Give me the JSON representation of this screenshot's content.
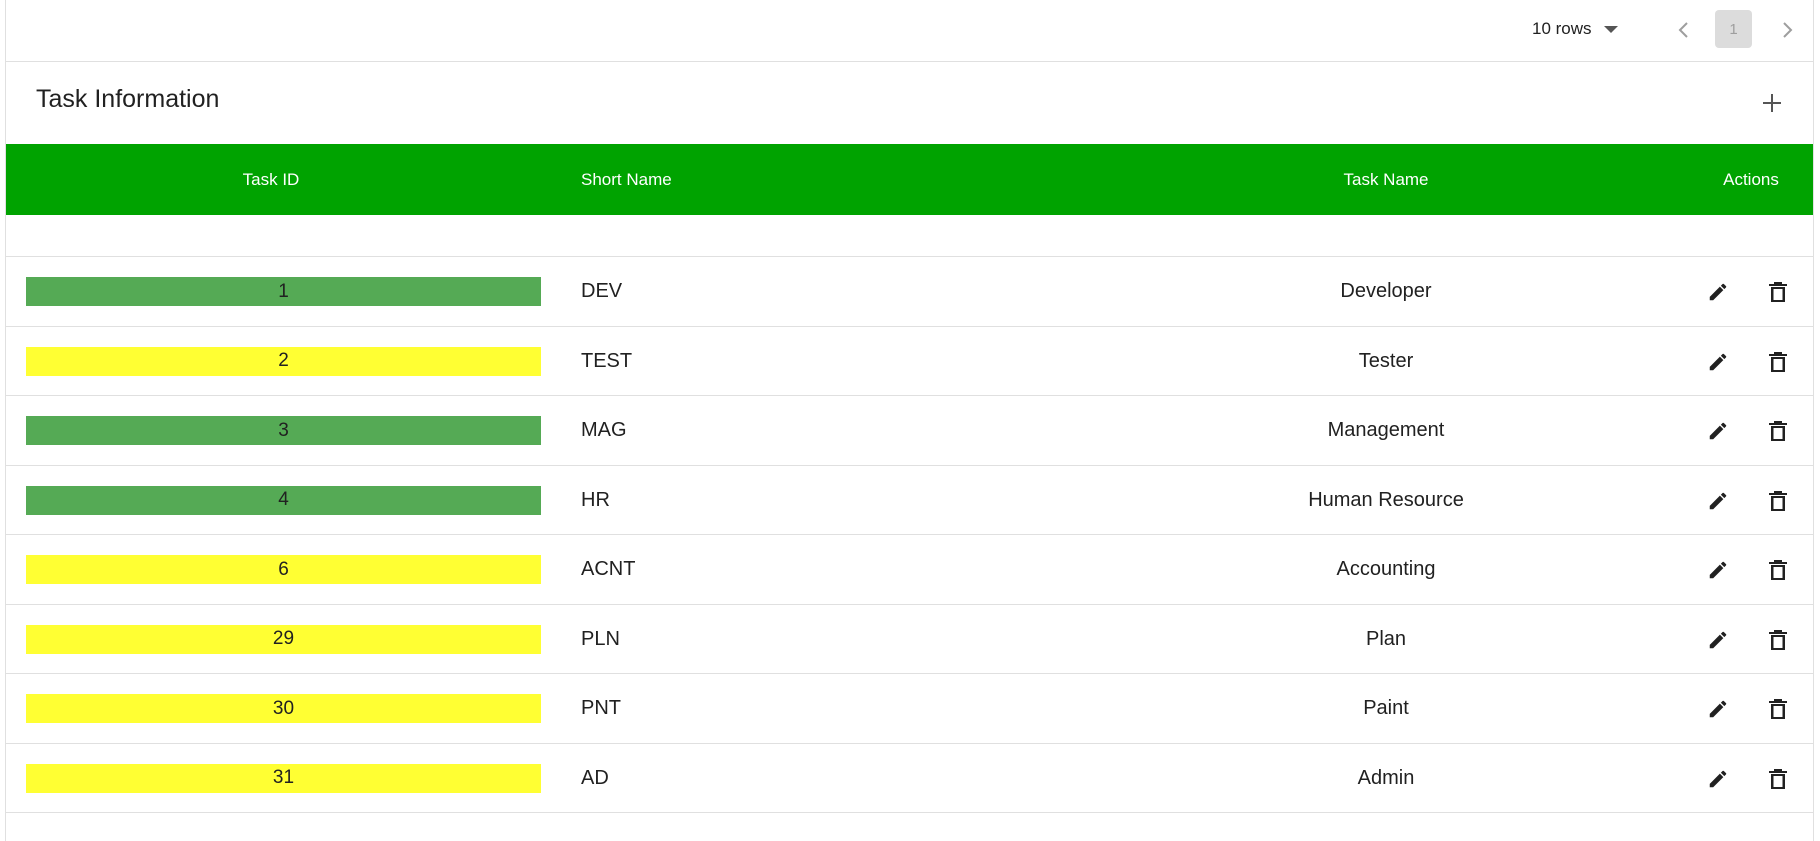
{
  "pagination": {
    "rows_label": "10 rows",
    "current_page": "1",
    "prev_icon": "chevron-left-icon",
    "next_icon": "chevron-right-icon"
  },
  "header": {
    "title": "Task Information",
    "add_icon": "plus-icon"
  },
  "table": {
    "columns": [
      "Task ID",
      "Short Name",
      "Task Name",
      "Actions"
    ],
    "header_color": "#00a300",
    "status_colors": {
      "green": "#55aa55",
      "yellow": "#ffff33"
    },
    "rows": [
      {
        "id": "1",
        "short": "DEV",
        "name": "Developer",
        "status": "green"
      },
      {
        "id": "2",
        "short": "TEST",
        "name": "Tester",
        "status": "yellow"
      },
      {
        "id": "3",
        "short": "MAG",
        "name": "Management",
        "status": "green"
      },
      {
        "id": "4",
        "short": "HR",
        "name": "Human Resource",
        "status": "green"
      },
      {
        "id": "6",
        "short": "ACNT",
        "name": "Accounting",
        "status": "yellow"
      },
      {
        "id": "29",
        "short": "PLN",
        "name": "Plan",
        "status": "yellow"
      },
      {
        "id": "30",
        "short": "PNT",
        "name": "Paint",
        "status": "yellow"
      },
      {
        "id": "31",
        "short": "AD",
        "name": "Admin",
        "status": "yellow"
      }
    ],
    "row_actions": [
      "edit-icon",
      "delete-icon"
    ]
  }
}
